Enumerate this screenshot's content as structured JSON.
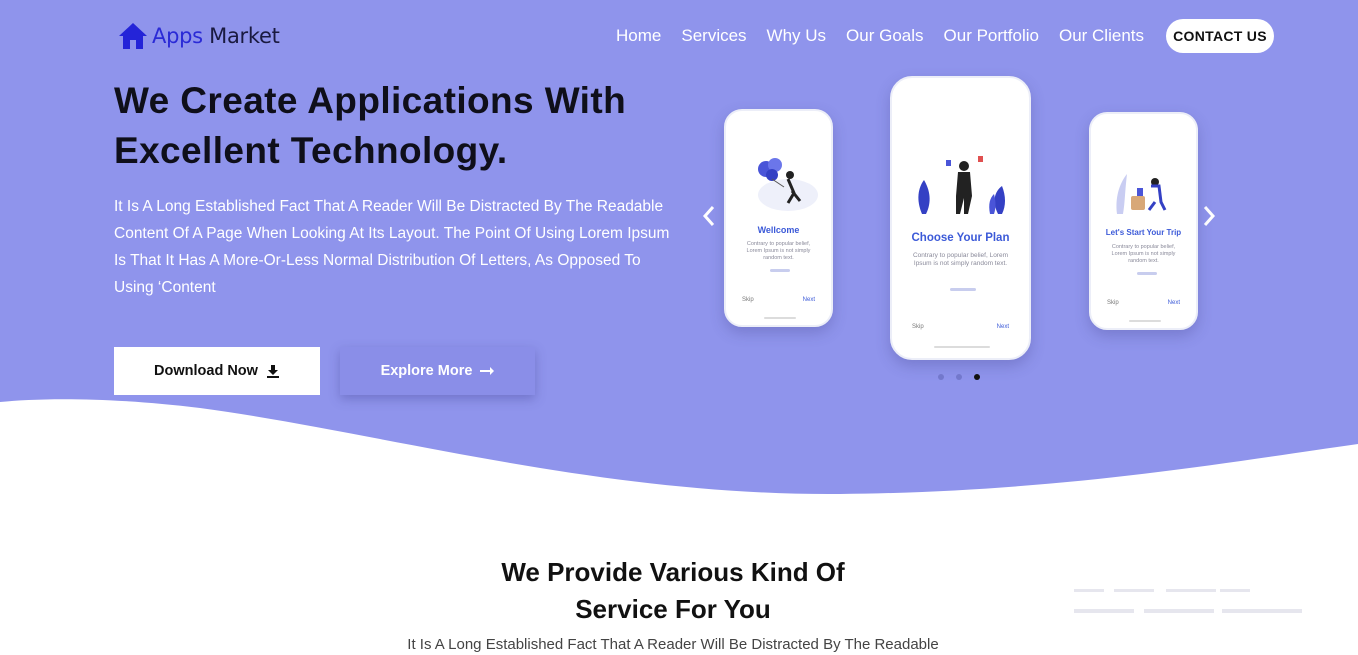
{
  "colors": {
    "hero_bg": "#8f94ec",
    "accent": "#3c5ad8",
    "logo_icon": "#2424d8"
  },
  "brand": {
    "part1": "Apps",
    "part2": " Market",
    "icon": "house-icon"
  },
  "nav": {
    "items": [
      "Home",
      "Services",
      "Why Us",
      "Our Goals",
      "Our Portfolio",
      "Our Clients"
    ],
    "contact_label": "CONTACT US"
  },
  "hero": {
    "title_line1": "We Create Applications With",
    "title_line2": "Excellent Technology.",
    "text": "It Is A Long Established Fact That A Reader Will Be Distracted By The Readable Content Of A Page When Looking At Its Layout. The Point Of Using Lorem Ipsum Is That It Has A More-Or-Less Normal Distribution Of Letters, As Opposed To Using ‘Content",
    "download_label": "Download Now",
    "download_icon": "download-icon",
    "explore_label": "Explore More",
    "explore_icon": "arrow-right-icon"
  },
  "carousel": {
    "prev_icon": "chevron-left-icon",
    "next_icon": "chevron-right-icon",
    "active_slide": 3,
    "slide_count": 3,
    "phones": [
      {
        "title": "Wellcome",
        "desc": "Contrary to popular belief, Lorem Ipsum is not simply random text.",
        "skip": "Skip",
        "next": "Next"
      },
      {
        "title": "Choose Your Plan",
        "desc": "Contrary to popular belief, Lorem Ipsum is not simply random text.",
        "skip": "Skip",
        "next": "Next"
      },
      {
        "title": "Let's Start Your Trip",
        "desc": "Contrary to popular belief, Lorem Ipsum is not simply random text.",
        "skip": "Skip",
        "next": "Next"
      }
    ]
  },
  "services": {
    "title_line1": "We Provide Various Kind Of",
    "title_line2": "Service For You",
    "text": "It Is A Long Established Fact That A Reader Will Be Distracted By The Readable"
  }
}
